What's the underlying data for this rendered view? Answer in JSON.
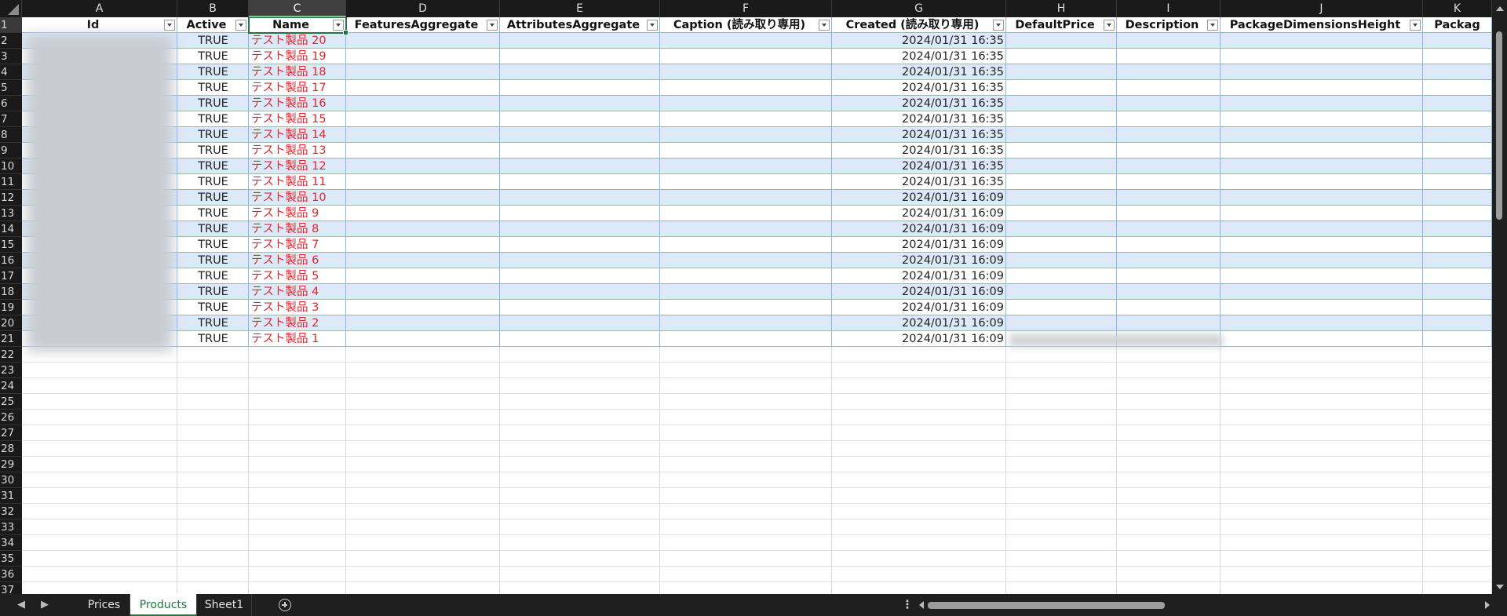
{
  "columns": [
    "A",
    "B",
    "C",
    "D",
    "E",
    "F",
    "G",
    "H",
    "I",
    "J",
    "K"
  ],
  "selected_column": "C",
  "headers": {
    "A": "Id",
    "B": "Active",
    "C": "Name",
    "D": "FeaturesAggregate",
    "E": "AttributesAggregate",
    "F": "Caption (読み取り専用)",
    "G": "Created (読み取り専用)",
    "H": "DefaultPrice",
    "I": "Description",
    "J": "PackageDimensionsHeight",
    "K": "Packag"
  },
  "rows": [
    {
      "active": "TRUE",
      "name": "テスト製品 20",
      "created": "2024/01/31 16:35"
    },
    {
      "active": "TRUE",
      "name": "テスト製品 19",
      "created": "2024/01/31 16:35"
    },
    {
      "active": "TRUE",
      "name": "テスト製品 18",
      "created": "2024/01/31 16:35"
    },
    {
      "active": "TRUE",
      "name": "テスト製品 17",
      "created": "2024/01/31 16:35"
    },
    {
      "active": "TRUE",
      "name": "テスト製品 16",
      "created": "2024/01/31 16:35"
    },
    {
      "active": "TRUE",
      "name": "テスト製品 15",
      "created": "2024/01/31 16:35"
    },
    {
      "active": "TRUE",
      "name": "テスト製品 14",
      "created": "2024/01/31 16:35"
    },
    {
      "active": "TRUE",
      "name": "テスト製品 13",
      "created": "2024/01/31 16:35"
    },
    {
      "active": "TRUE",
      "name": "テスト製品 12",
      "created": "2024/01/31 16:35"
    },
    {
      "active": "TRUE",
      "name": "テスト製品 11",
      "created": "2024/01/31 16:35"
    },
    {
      "active": "TRUE",
      "name": "テスト製品 10",
      "created": "2024/01/31 16:09"
    },
    {
      "active": "TRUE",
      "name": "テスト製品 9",
      "created": "2024/01/31 16:09"
    },
    {
      "active": "TRUE",
      "name": "テスト製品 8",
      "created": "2024/01/31 16:09"
    },
    {
      "active": "TRUE",
      "name": "テスト製品 7",
      "created": "2024/01/31 16:09"
    },
    {
      "active": "TRUE",
      "name": "テスト製品 6",
      "created": "2024/01/31 16:09"
    },
    {
      "active": "TRUE",
      "name": "テスト製品 5",
      "created": "2024/01/31 16:09"
    },
    {
      "active": "TRUE",
      "name": "テスト製品 4",
      "created": "2024/01/31 16:09"
    },
    {
      "active": "TRUE",
      "name": "テスト製品 3",
      "created": "2024/01/31 16:09"
    },
    {
      "active": "TRUE",
      "name": "テスト製品 2",
      "created": "2024/01/31 16:09"
    },
    {
      "active": "TRUE",
      "name": "テスト製品 1",
      "created": "2024/01/31 16:09"
    }
  ],
  "row_numbers": [
    "1",
    "2",
    "3",
    "4",
    "5",
    "6",
    "7",
    "8",
    "9",
    "10",
    "11",
    "12",
    "13",
    "14",
    "15",
    "16",
    "17",
    "18",
    "19",
    "20",
    "21",
    "22",
    "23",
    "24",
    "25",
    "26",
    "27",
    "28",
    "29",
    "30",
    "31",
    "32",
    "33",
    "34",
    "35",
    "36",
    "37"
  ],
  "sheet_tabs": [
    {
      "label": "Prices",
      "active": false
    },
    {
      "label": "Products",
      "active": true
    },
    {
      "label": "Sheet1",
      "active": false
    }
  ],
  "colors": {
    "name_text": "#e0262b",
    "band": "#dde9f6",
    "table_border": "#8db4e2",
    "active_tab": "#1e7a3c"
  },
  "icons": {
    "filter": "filter-dropdown-icon",
    "sort": "sort-ascending-icon",
    "add_sheet": "add-sheet-icon"
  }
}
